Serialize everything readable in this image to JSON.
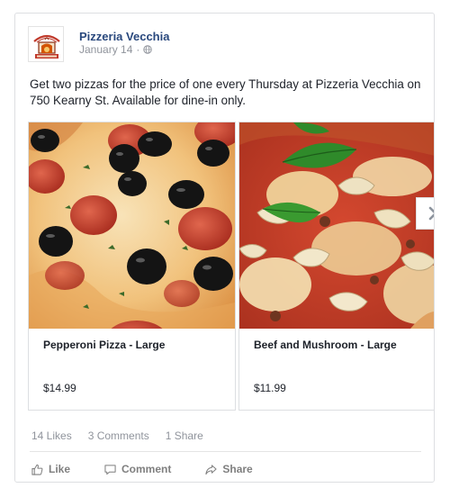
{
  "post": {
    "page_name": "Pizzeria Vecchia",
    "date": "January 14",
    "separator": "·",
    "visibility_icon": "globe-icon",
    "text": "Get two pizzas for the price of one every Thursday at Pizzeria Vecchia on 750 Kearny St. Available for dine-in only."
  },
  "carousel": {
    "cards": [
      {
        "title": "Pepperoni Pizza - Large",
        "price": "$14.99",
        "image": "pepperoni-pizza-photo"
      },
      {
        "title": "Beef and Mushroom - Large",
        "price": "$11.99",
        "image": "beef-mushroom-pizza-photo"
      }
    ],
    "next_icon": "chevron-right-icon"
  },
  "stats": {
    "likes": "14 Likes",
    "comments": "3 Comments",
    "shares": "1 Share"
  },
  "actions": {
    "like": "Like",
    "comment": "Comment",
    "share": "Share"
  },
  "colors": {
    "page_name": "#29487d",
    "meta": "#90949c",
    "border": "#dddfe2",
    "action_text": "#7f7f7f"
  }
}
